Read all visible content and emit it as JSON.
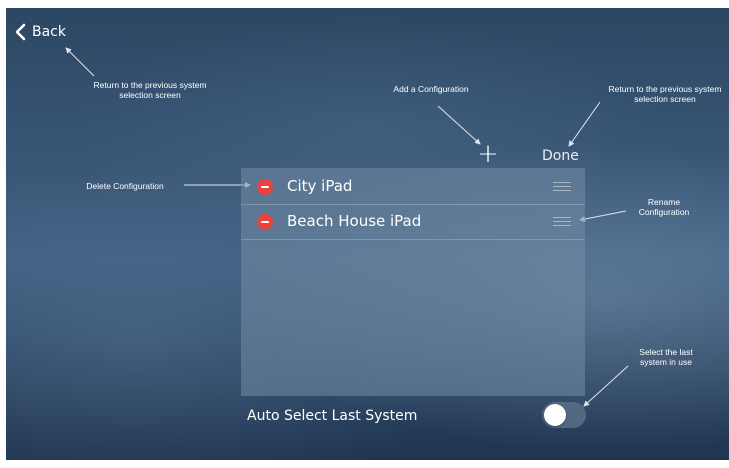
{
  "nav": {
    "back_label": "Back",
    "done_label": "Done",
    "add_symbol": "+"
  },
  "configurations": [
    {
      "label": "City iPad"
    },
    {
      "label": "Beach House iPad"
    }
  ],
  "auto_select": {
    "label": "Auto Select Last System",
    "enabled": false
  },
  "annotations": {
    "back": "Return to the previous system selection screen",
    "add": "Add a Configuration",
    "done": "Return to the previous system selection screen",
    "delete": "Delete Configuration",
    "rename": "Rename Configuration",
    "auto_select": "Select the last system in use"
  },
  "colors": {
    "delete_button": "#e8433d",
    "background": "#3b5878"
  },
  "icons": {
    "back": "chevron-left-icon",
    "add": "plus-icon",
    "delete": "minus-circle-icon",
    "reorder": "drag-handle-icon"
  }
}
